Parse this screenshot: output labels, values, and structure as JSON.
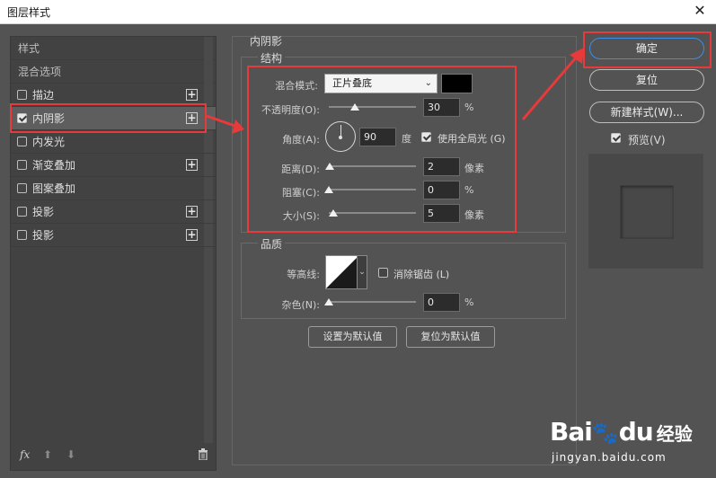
{
  "window": {
    "title": "图层样式",
    "close": "✕"
  },
  "left": {
    "header_styles": "样式",
    "header_blend": "混合选项",
    "items": [
      {
        "label": "描边",
        "checked": false,
        "plus": true
      },
      {
        "label": "内阴影",
        "checked": true,
        "plus": true
      },
      {
        "label": "内发光",
        "checked": false,
        "plus": false
      },
      {
        "label": "渐变叠加",
        "checked": false,
        "plus": true
      },
      {
        "label": "图案叠加",
        "checked": false,
        "plus": false
      },
      {
        "label": "投影",
        "checked": false,
        "plus": true
      },
      {
        "label": "投影",
        "checked": false,
        "plus": true
      }
    ],
    "footer": {
      "fx": "fx",
      "up": "⬆",
      "down": "⬇",
      "trash": "🗑"
    }
  },
  "inner_shadow": {
    "title": "内阴影",
    "structure_title": "结构",
    "blend_mode_label": "混合模式:",
    "blend_mode_value": "正片叠底",
    "shadow_color": "#000000",
    "opacity_label": "不透明度(O):",
    "opacity_value": "30",
    "opacity_unit": "%",
    "angle_label": "角度(A):",
    "angle_value": "90",
    "angle_unit": "度",
    "global_light_label": "使用全局光 (G)",
    "global_light_checked": true,
    "distance_label": "距离(D):",
    "distance_value": "2",
    "distance_unit": "像素",
    "choke_label": "阻塞(C):",
    "choke_value": "0",
    "choke_unit": "%",
    "size_label": "大小(S):",
    "size_value": "5",
    "size_unit": "像素",
    "quality_title": "品质",
    "contour_label": "等高线:",
    "antialias_label": "消除锯齿 (L)",
    "antialias_checked": false,
    "noise_label": "杂色(N):",
    "noise_value": "0",
    "noise_unit": "%",
    "set_default_label": "设置为默认值",
    "reset_default_label": "复位为默认值"
  },
  "buttons": {
    "ok": "确定",
    "reset": "复位",
    "new_style": "新建样式(W)...",
    "preview_label": "预览(V)",
    "preview_checked": true
  },
  "watermark": {
    "brand": "Bai",
    "brand_suffix": "du",
    "brand_cn": "经验",
    "url": "jingyan.baidu.com"
  },
  "colors": {
    "dialog_bg": "#535353",
    "highlight_red": "#e83a3a",
    "primary_blue": "#3d8ee6"
  }
}
